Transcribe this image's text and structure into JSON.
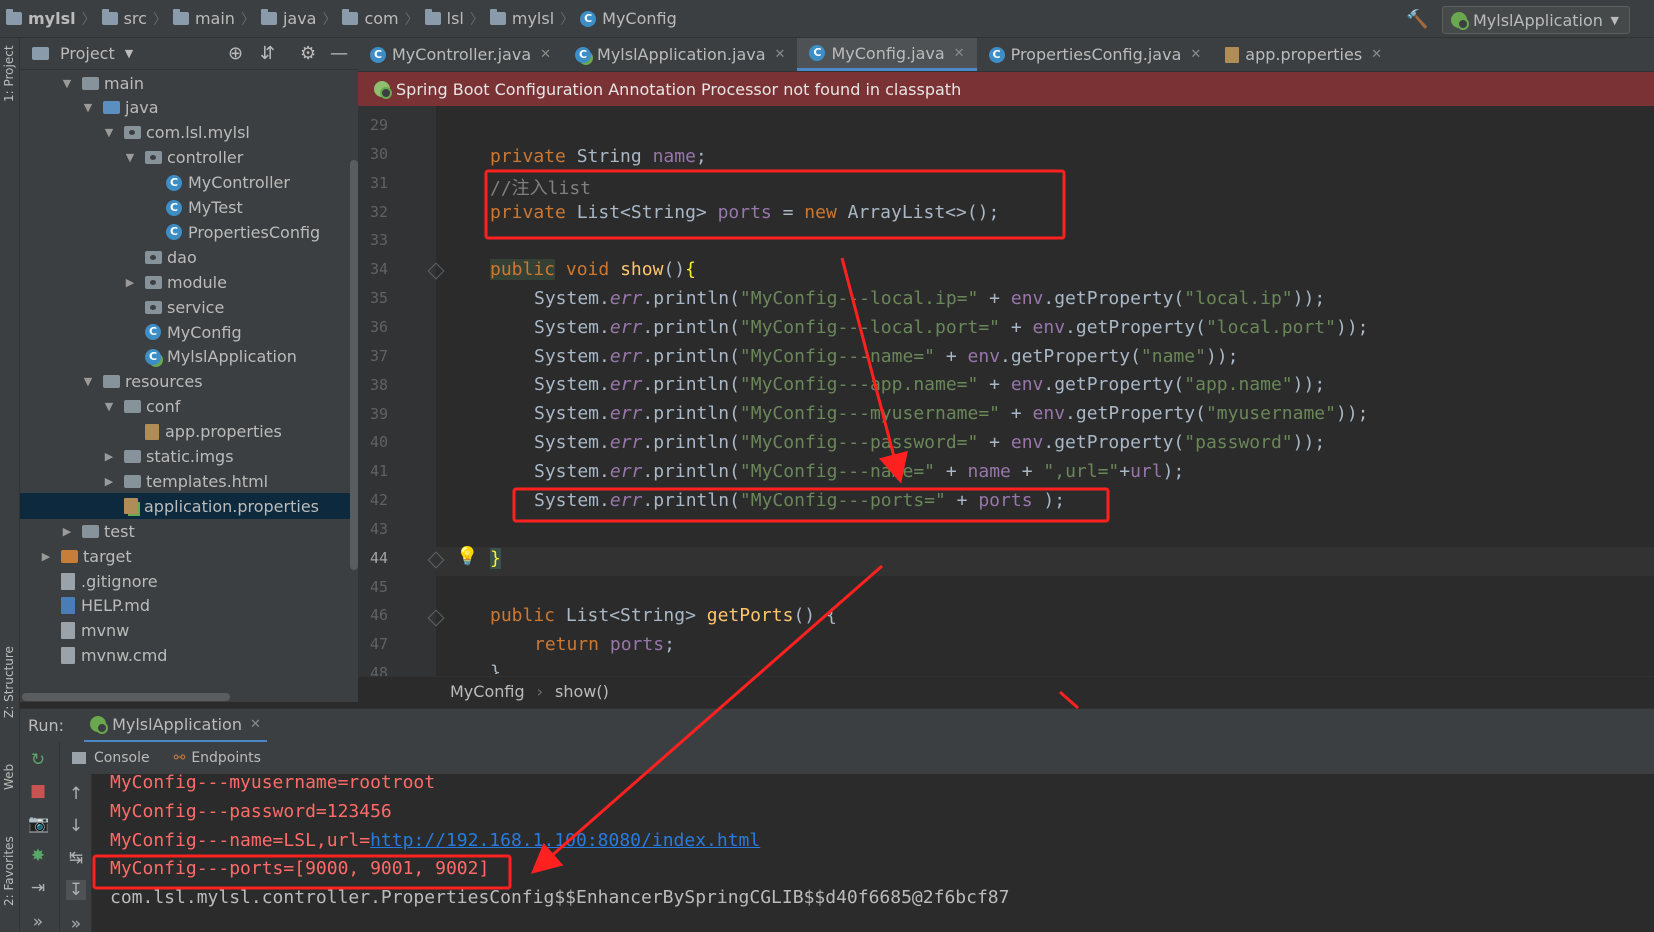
{
  "navbar": {
    "crumbs": [
      "mylsl",
      "src",
      "main",
      "java",
      "com",
      "lsl",
      "mylsl",
      "MyConfig"
    ],
    "run_config": "MylslApplication"
  },
  "left_strip": {
    "project_tab": "1: Project",
    "structure_tab": "Z: Structure",
    "web_tab": "Web",
    "favorites_tab": "2: Favorites"
  },
  "project": {
    "title": "Project",
    "tree": [
      {
        "label": "main",
        "depth": 2,
        "arrow": "down",
        "icon": "folder"
      },
      {
        "label": "java",
        "depth": 3,
        "arrow": "down",
        "icon": "folder-blue"
      },
      {
        "label": "com.lsl.mylsl",
        "depth": 4,
        "arrow": "down",
        "icon": "package"
      },
      {
        "label": "controller",
        "depth": 5,
        "arrow": "down",
        "icon": "package"
      },
      {
        "label": "MyController",
        "depth": 6,
        "arrow": "",
        "icon": "class"
      },
      {
        "label": "MyTest",
        "depth": 6,
        "arrow": "",
        "icon": "class"
      },
      {
        "label": "PropertiesConfig",
        "depth": 6,
        "arrow": "",
        "icon": "class"
      },
      {
        "label": "dao",
        "depth": 5,
        "arrow": "",
        "icon": "package"
      },
      {
        "label": "module",
        "depth": 5,
        "arrow": "right",
        "icon": "package"
      },
      {
        "label": "service",
        "depth": 5,
        "arrow": "",
        "icon": "package"
      },
      {
        "label": "MyConfig",
        "depth": 5,
        "arrow": "",
        "icon": "class"
      },
      {
        "label": "MylslApplication",
        "depth": 5,
        "arrow": "",
        "icon": "spring-class"
      },
      {
        "label": "resources",
        "depth": 3,
        "arrow": "down",
        "icon": "folder"
      },
      {
        "label": "conf",
        "depth": 4,
        "arrow": "down",
        "icon": "folder"
      },
      {
        "label": "app.properties",
        "depth": 5,
        "arrow": "",
        "icon": "properties"
      },
      {
        "label": "static.imgs",
        "depth": 4,
        "arrow": "right",
        "icon": "folder"
      },
      {
        "label": "templates.html",
        "depth": 4,
        "arrow": "right",
        "icon": "folder"
      },
      {
        "label": "application.properties",
        "depth": 4,
        "arrow": "",
        "icon": "spring-properties",
        "selected": true
      },
      {
        "label": "test",
        "depth": 2,
        "arrow": "right",
        "icon": "folder"
      },
      {
        "label": "target",
        "depth": 1,
        "arrow": "right",
        "icon": "folder-orange"
      },
      {
        "label": ".gitignore",
        "depth": 1,
        "arrow": "",
        "icon": "file"
      },
      {
        "label": "HELP.md",
        "depth": 1,
        "arrow": "",
        "icon": "md"
      },
      {
        "label": "mvnw",
        "depth": 1,
        "arrow": "",
        "icon": "file"
      },
      {
        "label": "mvnw.cmd",
        "depth": 1,
        "arrow": "",
        "icon": "file"
      }
    ]
  },
  "tabs": [
    {
      "label": "MyController.java",
      "icon": "class",
      "active": false
    },
    {
      "label": "MylslApplication.java",
      "icon": "spring-class",
      "active": false
    },
    {
      "label": "MyConfig.java",
      "icon": "class",
      "active": true
    },
    {
      "label": "PropertiesConfig.java",
      "icon": "class",
      "active": false
    },
    {
      "label": "app.properties",
      "icon": "properties",
      "active": false
    }
  ],
  "banner": {
    "message": "Spring Boot Configuration Annotation Processor not found in classpath"
  },
  "editor": {
    "line_numbers": [
      "29",
      "30",
      "31",
      "32",
      "33",
      "34",
      "35",
      "36",
      "37",
      "38",
      "39",
      "40",
      "41",
      "42",
      "43",
      "44",
      "45",
      "46",
      "47",
      "48"
    ],
    "current_line": "44",
    "lines": {
      "l30": "private String name;",
      "l31": "//注入list",
      "l32": "private List<String> ports = new ArrayList<>();",
      "l34": "public void show(){",
      "l35": "System.err.println(\"MyConfig---local.ip=\" + env.getProperty(\"local.ip\"));",
      "l36": "System.err.println(\"MyConfig---local.port=\" + env.getProperty(\"local.port\"));",
      "l37": "System.err.println(\"MyConfig---name=\" + env.getProperty(\"name\"));",
      "l38": "System.err.println(\"MyConfig---app.name=\" + env.getProperty(\"app.name\"));",
      "l39": "System.err.println(\"MyConfig---myusername=\" + env.getProperty(\"myusername\"));",
      "l40": "System.err.println(\"MyConfig---password=\" + env.getProperty(\"password\"));",
      "l41": "System.err.println(\"MyConfig---name=\" + name + \",url=\"+url);",
      "l42": "System.err.println(\"MyConfig---ports=\" + ports );",
      "l44": "}",
      "l46": "public List<String> getPorts() {",
      "l47": "return ports;",
      "l48": "}"
    }
  },
  "editor_crumb": {
    "class_name": "MyConfig",
    "method_name": "show()"
  },
  "run": {
    "label": "Run:",
    "tab": "MylslApplication",
    "console_tab": "Console",
    "endpoints_tab": "Endpoints",
    "output": [
      {
        "text": "MyConfig---myusername=rootroot"
      },
      {
        "text": "MyConfig---password=123456"
      },
      {
        "prefix": "MyConfig---name=LSL,url=",
        "link": "http://192.168.1.100:8080/index.html"
      },
      {
        "text": "MyConfig---ports=[9000, 9001, 9002]"
      },
      {
        "text": "com.lsl.mylsl.controller.PropertiesConfig$$EnhancerBySpringCGLIB$$d40f6685@2f6bcf87"
      }
    ]
  },
  "colors": {
    "annotation": "#ff2020",
    "banner": "#7b3234",
    "console_error": "#ff6b68",
    "keyword": "#cc7832",
    "string": "#6a8759"
  }
}
